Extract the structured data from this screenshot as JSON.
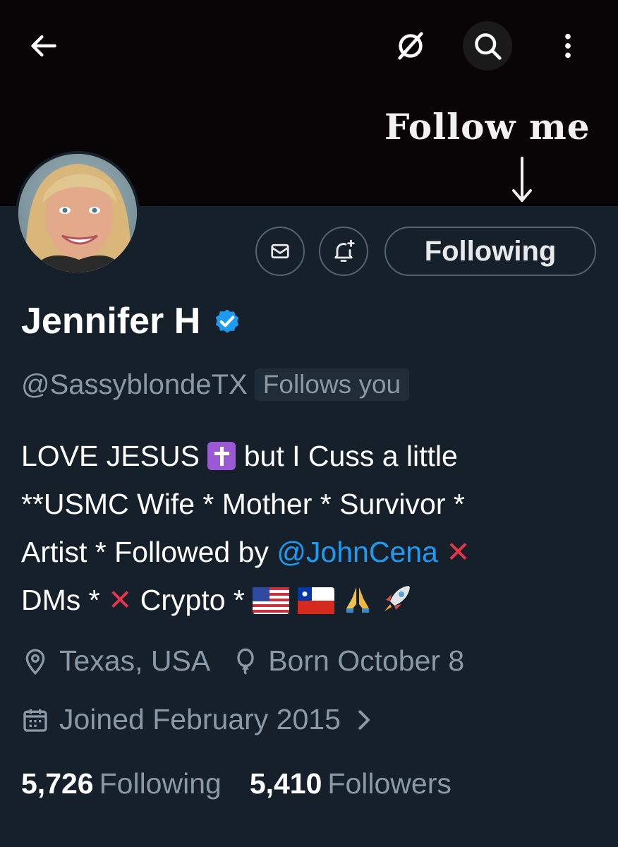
{
  "topbar": {
    "back_icon": "arrow-left-icon",
    "grok_icon": "grok-icon",
    "search_icon": "search-icon",
    "more_icon": "more-vertical-icon"
  },
  "banner": {
    "caption": "Follow me",
    "arrow_icon": "arrow-down-icon"
  },
  "profile": {
    "name": "Jennifer H",
    "handle": "@SassyblondeTX",
    "follows_you": "Follows you",
    "verified": true,
    "bio": {
      "line1_a": "LOVE JESUS",
      "line1_b": "but I Cuss a little",
      "line2": "**USMC Wife * Mother * Survivor *",
      "line3_a": "Artist * Followed by",
      "mention": "@JohnCena",
      "line4_a": "DMs *",
      "line4_b": "Crypto *"
    },
    "location": "Texas, USA",
    "birthday": "Born October 8",
    "joined": "Joined February 2015"
  },
  "actions": {
    "message_icon": "mail-icon",
    "notify_icon": "bell-plus-icon",
    "following_label": "Following"
  },
  "stats": {
    "following_count": "5,726",
    "following_label": "Following",
    "followers_count": "5,410",
    "followers_label": "Followers"
  },
  "colors": {
    "background": "#15202b",
    "banner": "#080506",
    "accent": "#1d9bf0",
    "muted": "#8b98a5"
  }
}
